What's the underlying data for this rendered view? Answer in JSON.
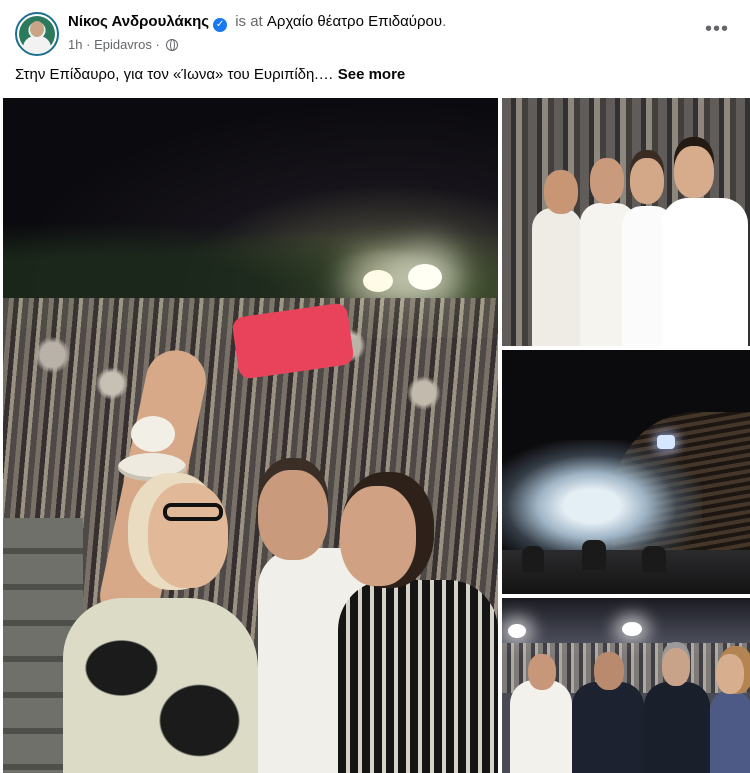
{
  "post": {
    "author": "Νίκος Ανδρουλάκης",
    "verified_badge": "verified-badge-icon",
    "is_at": "is at",
    "place": "Αρχαίο θέατρο Επιδαύρου",
    "place_suffix": ".",
    "time": "1h",
    "separator": "·",
    "location": "Epidavros",
    "separator2": "·",
    "audience_icon": "globe-icon",
    "more_options": "•••",
    "caption": "Στην Επίδαυρο, για τον «Ίωνα» του Ευριπίδη.…",
    "see_more": "See more"
  },
  "photos": [
    {
      "name": "selfie-photo"
    },
    {
      "name": "audience-group-photo"
    },
    {
      "name": "theatre-stage-photo"
    },
    {
      "name": "group-portrait-photo"
    }
  ],
  "colors": {
    "verified": "#1877f2",
    "secondary_text": "#65676b",
    "primary_text": "#050505"
  }
}
